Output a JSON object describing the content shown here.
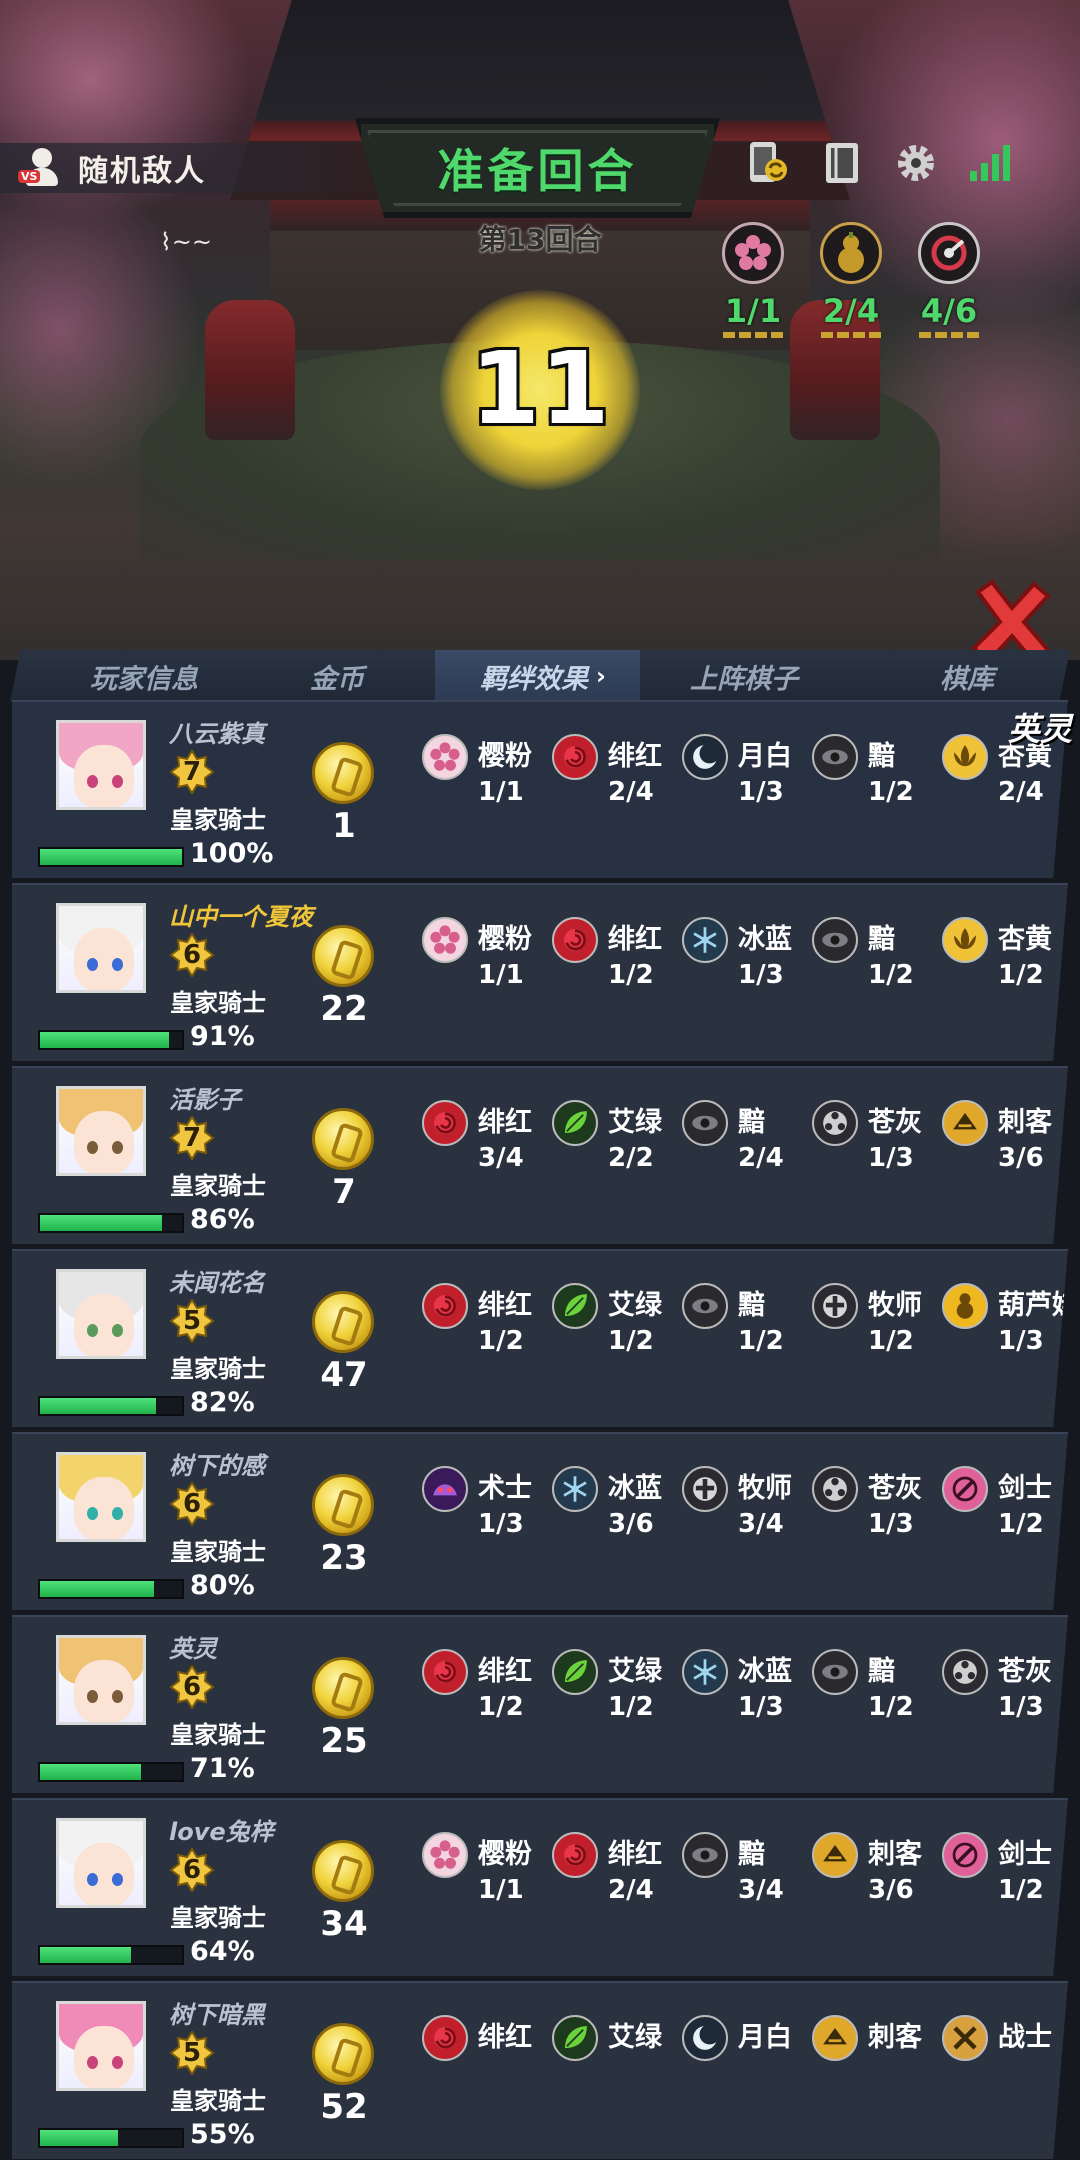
{
  "header": {
    "enemy_label": "随机敌人",
    "enemy_sub": "⌇~~",
    "phase_title": "准备回合",
    "round_label": "第13回合",
    "timer": "11"
  },
  "top_icons": [
    "phone-swap-icon",
    "deck-icon",
    "gear-icon",
    "signal-icon"
  ],
  "trait_tracker": [
    {
      "icon": "sakura-icon",
      "count": "1/1",
      "color": "#e07aa0"
    },
    {
      "icon": "gourd-icon",
      "count": "2/4",
      "color": "#c49a2a"
    },
    {
      "icon": "spiral-icon",
      "count": "4/6",
      "color": "#d43a4a"
    }
  ],
  "tabs": {
    "player_info": "玩家信息",
    "gold": "金币",
    "bond_effects": "羁绊效果",
    "bond_chevron": "›",
    "deployed": "上阵棋子",
    "bench": "棋库"
  },
  "overflow_name": "英灵",
  "colors": {
    "hp_green": "#2fc85a",
    "self_name": "#f0c638",
    "accent": "#4fd86b"
  },
  "players": [
    {
      "name": "八云紫真",
      "level": "7",
      "title": "皇家骑士",
      "hp": "100%",
      "hp_value": 1.0,
      "gold": "1",
      "self": false,
      "avatar": {
        "hair": "#f0a6c4",
        "eye": "#c9437a"
      },
      "traits": [
        {
          "icon": "sakura-icon",
          "name": "樱粉",
          "count": "1/1"
        },
        {
          "icon": "rose-icon",
          "name": "绯红",
          "count": "2/4"
        },
        {
          "icon": "moon-icon",
          "name": "月白",
          "count": "1/3"
        },
        {
          "icon": "dark-eye-icon",
          "name": "黯",
          "count": "1/2"
        },
        {
          "icon": "lotus-icon",
          "name": "杏黄",
          "count": "2/4"
        }
      ]
    },
    {
      "name": "山中一个夏夜",
      "level": "6",
      "title": "皇家骑士",
      "hp": "91%",
      "hp_value": 0.91,
      "gold": "22",
      "self": true,
      "avatar": {
        "hair": "#f2f2f2",
        "eye": "#3a6bd6"
      },
      "traits": [
        {
          "icon": "sakura-icon",
          "name": "樱粉",
          "count": "1/1"
        },
        {
          "icon": "rose-icon",
          "name": "绯红",
          "count": "1/2"
        },
        {
          "icon": "snowflake-icon",
          "name": "冰蓝",
          "count": "1/3"
        },
        {
          "icon": "dark-eye-icon",
          "name": "黯",
          "count": "1/2"
        },
        {
          "icon": "lotus-icon",
          "name": "杏黄",
          "count": "1/2"
        }
      ]
    },
    {
      "name": "活影子",
      "level": "7",
      "title": "皇家骑士",
      "hp": "86%",
      "hp_value": 0.86,
      "gold": "7",
      "self": false,
      "avatar": {
        "hair": "#f0c274",
        "eye": "#7a5b3a"
      },
      "traits": [
        {
          "icon": "rose-icon",
          "name": "绯红",
          "count": "3/4"
        },
        {
          "icon": "leaf-icon",
          "name": "艾绿",
          "count": "2/2"
        },
        {
          "icon": "dark-eye-icon",
          "name": "黯",
          "count": "2/4"
        },
        {
          "icon": "triskele-icon",
          "name": "苍灰",
          "count": "1/3"
        },
        {
          "icon": "assassin-icon",
          "name": "刺客",
          "count": "3/6"
        }
      ]
    },
    {
      "name": "未闻花名",
      "level": "5",
      "title": "皇家骑士",
      "hp": "82%",
      "hp_value": 0.82,
      "gold": "47",
      "self": false,
      "avatar": {
        "hair": "#e6e6e6",
        "eye": "#5a9a5a"
      },
      "traits": [
        {
          "icon": "rose-icon",
          "name": "绯红",
          "count": "1/2"
        },
        {
          "icon": "leaf-icon",
          "name": "艾绿",
          "count": "1/2"
        },
        {
          "icon": "dark-eye-icon",
          "name": "黯",
          "count": "1/2"
        },
        {
          "icon": "cross-icon",
          "name": "牧师",
          "count": "1/2"
        },
        {
          "icon": "gourd-icon",
          "name": "葫芦娃",
          "count": "1/3"
        }
      ]
    },
    {
      "name": "树下的感",
      "level": "6",
      "title": "皇家骑士",
      "hp": "80%",
      "hp_value": 0.8,
      "gold": "23",
      "self": false,
      "avatar": {
        "hair": "#f3d36b",
        "eye": "#2fb0a8"
      },
      "traits": [
        {
          "icon": "warlock-icon",
          "name": "术士",
          "count": "1/3"
        },
        {
          "icon": "snowflake-icon",
          "name": "冰蓝",
          "count": "3/6"
        },
        {
          "icon": "cross-icon",
          "name": "牧师",
          "count": "3/4"
        },
        {
          "icon": "triskele-icon",
          "name": "苍灰",
          "count": "1/3"
        },
        {
          "icon": "swordsman-icon",
          "name": "剑士",
          "count": "1/2"
        }
      ]
    },
    {
      "name": "英灵",
      "level": "6",
      "title": "皇家骑士",
      "hp": "71%",
      "hp_value": 0.71,
      "gold": "25",
      "self": false,
      "avatar": {
        "hair": "#f0c274",
        "eye": "#7a5b3a"
      },
      "traits": [
        {
          "icon": "rose-icon",
          "name": "绯红",
          "count": "1/2"
        },
        {
          "icon": "leaf-icon",
          "name": "艾绿",
          "count": "1/2"
        },
        {
          "icon": "snowflake-icon",
          "name": "冰蓝",
          "count": "1/3"
        },
        {
          "icon": "dark-eye-icon",
          "name": "黯",
          "count": "1/2"
        },
        {
          "icon": "triskele-icon",
          "name": "苍灰",
          "count": "1/3"
        }
      ]
    },
    {
      "name": "love兔梓",
      "level": "6",
      "title": "皇家骑士",
      "hp": "64%",
      "hp_value": 0.64,
      "gold": "34",
      "self": false,
      "avatar": {
        "hair": "#f2f2f2",
        "eye": "#3a6bd6"
      },
      "traits": [
        {
          "icon": "sakura-icon",
          "name": "樱粉",
          "count": "1/1"
        },
        {
          "icon": "rose-icon",
          "name": "绯红",
          "count": "2/4"
        },
        {
          "icon": "dark-eye-icon",
          "name": "黯",
          "count": "3/4"
        },
        {
          "icon": "assassin-icon",
          "name": "刺客",
          "count": "3/6"
        },
        {
          "icon": "swordsman-icon",
          "name": "剑士",
          "count": "1/2"
        }
      ]
    },
    {
      "name": "树下暗黑",
      "level": "5",
      "title": "皇家骑士",
      "hp": "55%",
      "hp_value": 0.55,
      "gold": "52",
      "self": false,
      "avatar": {
        "hair": "#f08ab8",
        "eye": "#c9437a"
      },
      "traits": [
        {
          "icon": "rose-icon",
          "name": "绯红",
          "count": ""
        },
        {
          "icon": "leaf-icon",
          "name": "艾绿",
          "count": ""
        },
        {
          "icon": "moon-icon",
          "name": "月白",
          "count": ""
        },
        {
          "icon": "assassin-icon",
          "name": "刺客",
          "count": ""
        },
        {
          "icon": "warrior-icon",
          "name": "战士",
          "count": ""
        }
      ]
    }
  ]
}
